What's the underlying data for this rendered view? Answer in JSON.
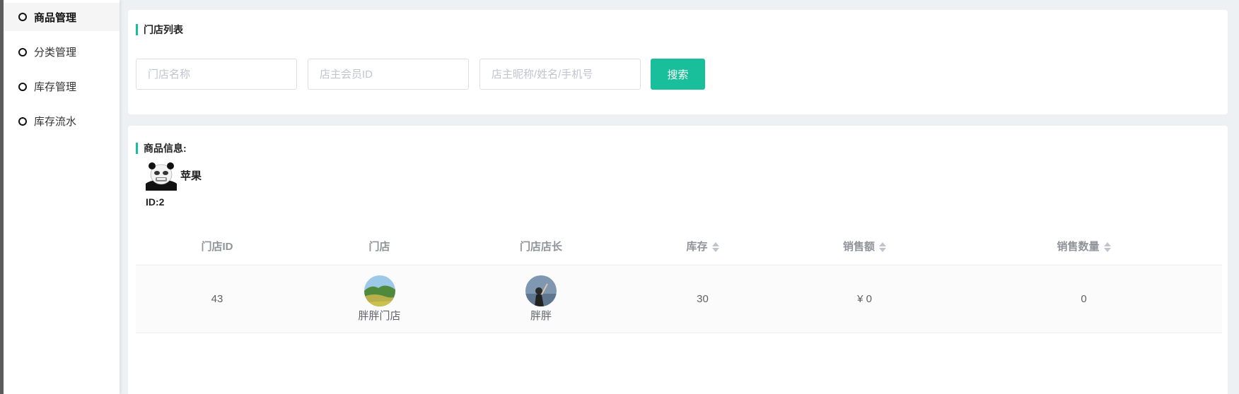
{
  "sidebar": {
    "items": [
      {
        "label": "商品管理",
        "active": true
      },
      {
        "label": "分类管理",
        "active": false
      },
      {
        "label": "库存管理",
        "active": false
      },
      {
        "label": "库存流水",
        "active": false
      }
    ]
  },
  "store_list": {
    "title": "门店列表",
    "store_name_placeholder": "门店名称",
    "owner_id_placeholder": "店主会员ID",
    "owner_info_placeholder": "店主昵称/姓名/手机号",
    "search_label": "搜索"
  },
  "goods_info": {
    "title": "商品信息:",
    "name": "苹果",
    "id_text": "ID:2",
    "image_icon": "panda-meme-image"
  },
  "table": {
    "columns": [
      "门店ID",
      "门店",
      "门店店长",
      "库存",
      "销售额",
      "销售数量"
    ],
    "rows": [
      {
        "store_id": "43",
        "store_name": "胖胖门店",
        "manager": "胖胖",
        "stock": "30",
        "sales": "¥ 0",
        "sales_qty": "0"
      }
    ]
  },
  "colors": {
    "accent": "#19be9b",
    "background": "#eef1f4"
  }
}
